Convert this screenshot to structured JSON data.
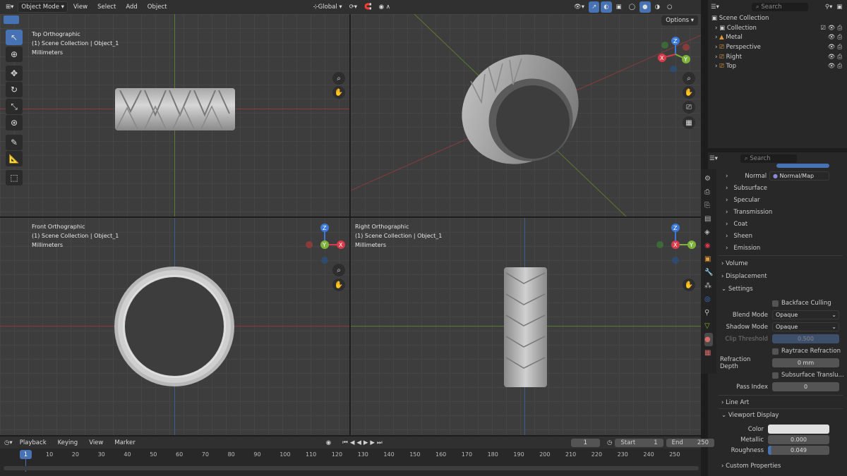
{
  "topbar": {
    "mode": "Object Mode",
    "menus": [
      "View",
      "Select",
      "Add",
      "Object"
    ],
    "transform": "Global"
  },
  "viewports": {
    "top": {
      "title": "Top Orthographic",
      "collection": "(1) Scene Collection | Object_1",
      "units": "Millimeters"
    },
    "persp": {
      "options": "Options"
    },
    "front": {
      "title": "Front Orthographic",
      "collection": "(1) Scene Collection | Object_1",
      "units": "Millimeters"
    },
    "right": {
      "title": "Right Orthographic",
      "collection": "(1) Scene Collection | Object_1",
      "units": "Millimeters"
    }
  },
  "gizmo": {
    "x": "X",
    "y": "Y",
    "z": "Z"
  },
  "outliner": {
    "search": "Search",
    "root": "Scene Collection",
    "items": [
      "Collection",
      "Metal",
      "Perspective",
      "Right",
      "Top"
    ]
  },
  "props": {
    "search": "Search",
    "normal_label": "Normal",
    "normal_value": "Normal/Map",
    "sections": [
      "Subsurface",
      "Specular",
      "Transmission",
      "Coat",
      "Sheen",
      "Emission"
    ],
    "volume": "Volume",
    "displacement": "Displacement",
    "settings": "Settings",
    "backface": "Backface Culling",
    "blend_label": "Blend Mode",
    "blend_value": "Opaque",
    "shadow_label": "Shadow Mode",
    "shadow_value": "Opaque",
    "clip_label": "Clip Threshold",
    "clip_value": "0.500",
    "raytrace": "Raytrace Refraction",
    "refr_label": "Refraction Depth",
    "refr_value": "0 mm",
    "subsurf": "Subsurface Translu...",
    "pass_label": "Pass Index",
    "pass_value": "0",
    "lineart": "Line Art",
    "viewport_display": "Viewport Display",
    "color_label": "Color",
    "metallic_label": "Metallic",
    "metallic_value": "0.000",
    "rough_label": "Roughness",
    "rough_value": "0.049",
    "custom": "Custom Properties"
  },
  "timeline": {
    "menus": [
      "Playback",
      "Keying",
      "View",
      "Marker"
    ],
    "frame": "1",
    "start_label": "Start",
    "start": "1",
    "end_label": "End",
    "end": "250",
    "ticks": [
      "1",
      "10",
      "20",
      "30",
      "40",
      "50",
      "60",
      "70",
      "80",
      "90",
      "100",
      "110",
      "120",
      "130",
      "140",
      "150",
      "160",
      "170",
      "180",
      "190",
      "200",
      "210",
      "220",
      "230",
      "240",
      "250"
    ]
  }
}
